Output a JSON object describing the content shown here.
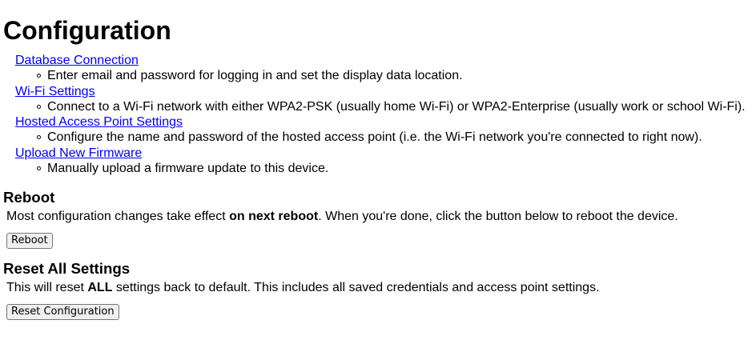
{
  "page": {
    "title": "Configuration"
  },
  "links": [
    {
      "label": "Database Connection",
      "description": "Enter email and password for logging in and set the display data location."
    },
    {
      "label": "Wi-Fi Settings",
      "description": "Connect to a Wi-Fi network with either WPA2-PSK (usually home Wi-Fi) or WPA2-Enterprise (usually work or school Wi-Fi)."
    },
    {
      "label": "Hosted Access Point Settings",
      "description": "Configure the name and password of the hosted access point (i.e. the Wi-Fi network you're connected to right now)."
    },
    {
      "label": "Upload New Firmware",
      "description": "Manually upload a firmware update to this device."
    }
  ],
  "reboot": {
    "heading": "Reboot",
    "text_before": "Most configuration changes take effect ",
    "text_bold": "on next reboot",
    "text_after": ". When you're done, click the button below to reboot the device.",
    "button_label": "Reboot"
  },
  "reset": {
    "heading": "Reset All Settings",
    "text_before": "This will reset ",
    "text_bold": "ALL",
    "text_after": " settings back to default. This includes all saved credentials and access point settings.",
    "button_label": "Reset Configuration"
  }
}
